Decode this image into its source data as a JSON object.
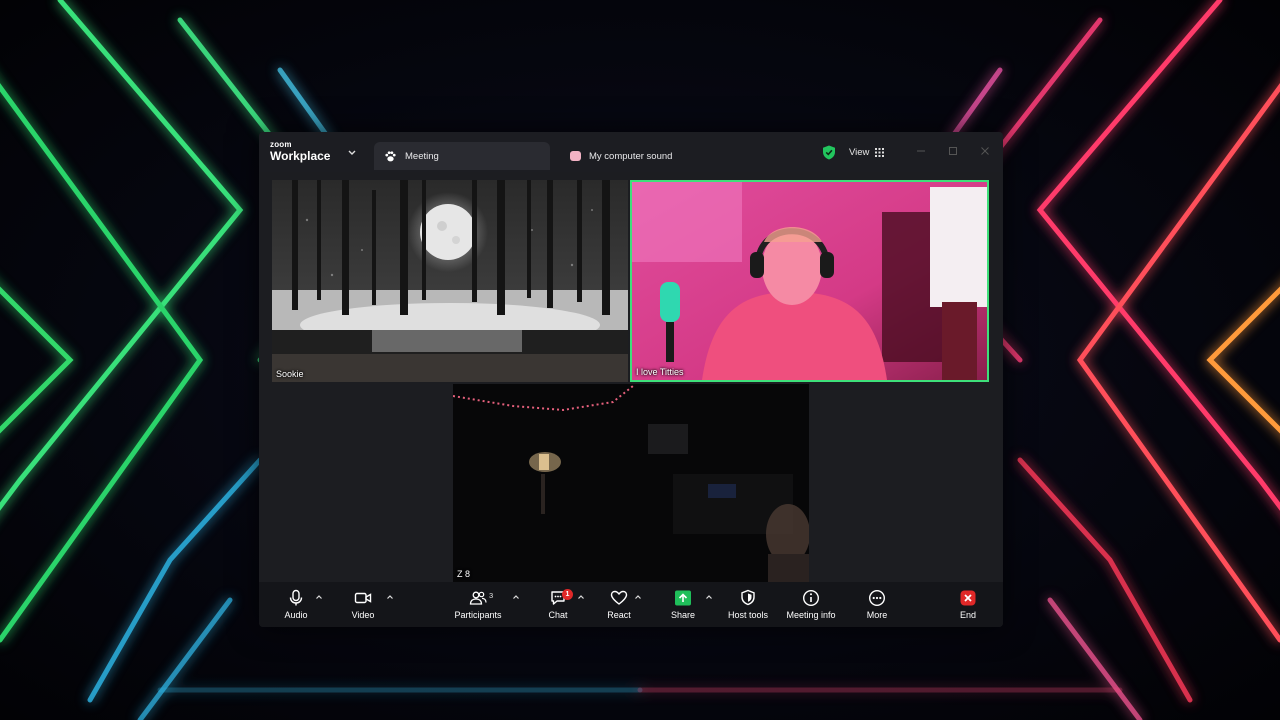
{
  "window": {
    "brand_small": "zoom",
    "brand_big": "Workplace",
    "tabs": [
      {
        "label": "Meeting",
        "icon": "paw-icon"
      },
      {
        "label": "My computer sound",
        "icon": "sound-share-icon"
      }
    ],
    "view_label": "View"
  },
  "participants": [
    {
      "name": "Sookie",
      "tile": "moonlit forest"
    },
    {
      "name": "I love Titties",
      "tile": "active speaker",
      "highlight_color": "#3ee07a"
    },
    {
      "name": "Z 8",
      "tile": "dark room"
    }
  ],
  "toolbar": {
    "audio": "Audio",
    "video": "Video",
    "participants": "Participants",
    "participants_count": "3",
    "chat": "Chat",
    "chat_badge": "1",
    "react": "React",
    "share": "Share",
    "host_tools": "Host tools",
    "meeting_info": "Meeting info",
    "more": "More",
    "end": "End"
  },
  "colors": {
    "share_green": "#1fbf5a",
    "end_red": "#e02828",
    "speaker_border": "#3ee07a",
    "shield_green": "#22c55e"
  }
}
